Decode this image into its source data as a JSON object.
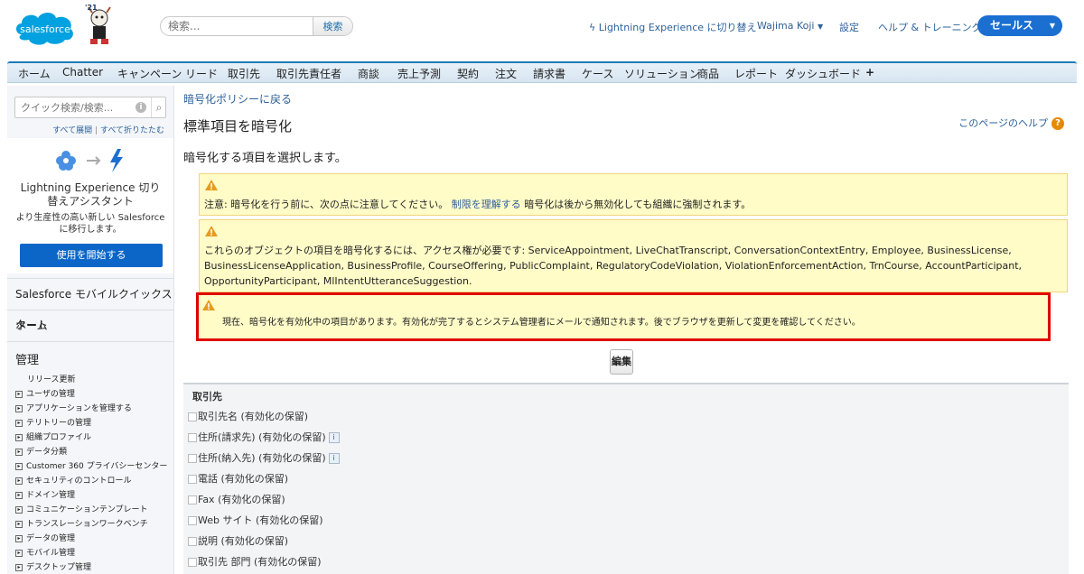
{
  "header": {
    "logo_text": "salesforce",
    "mascot_badge": "'21",
    "search_placeholder": "検索...",
    "search_button": "検索",
    "lightning_link": "Lightning Experience に切り替え",
    "user_menu": "Wajima Koji",
    "setup_link": "設定",
    "help_link": "ヘルプ & トレーニング",
    "app_switcher": "セールス"
  },
  "tabs": [
    "ホーム",
    "Chatter",
    "キャンペーン",
    "リード",
    "取引先",
    "取引先責任者",
    "商談",
    "売上予測",
    "契約",
    "注文",
    "請求書",
    "ケース",
    "ソリューション",
    "商品",
    "レポート",
    "ダッシュボード",
    "+"
  ],
  "sidebar": {
    "quick_search_placeholder": "クイック検索/検索...",
    "expand_all": "すべて展開",
    "collapse_all": "すべて折りたたむ",
    "separator": "|",
    "assistant_title": "Lightning Experience 切り替えアシスタント",
    "assistant_desc": "より生産性の高い新しい Salesforce に移行します。",
    "assistant_button": "使用を開始する",
    "mobile_quickstart": "Salesforce モバイルクイックスタート",
    "home": "ホーム",
    "admin_title": "管理",
    "release_updates": "リリース更新",
    "admin_items": [
      "ユーザの管理",
      "アプリケーションを管理する",
      "テリトリーの管理",
      "組織プロファイル",
      "データ分類",
      "Customer 360 プライバシーセンター",
      "セキュリティのコントロール",
      "ドメイン管理",
      "コミュニケーションテンプレート",
      "トランスレーションワークベンチ",
      "データの管理",
      "モバイル管理",
      "デスクトップ管理"
    ]
  },
  "main": {
    "back_link": "暗号化ポリシーに戻る",
    "title": "標準項目を暗号化",
    "help_link": "このページのヘルプ",
    "instruction": "暗号化する項目を選択します。",
    "warning1_prefix": "注意: 暗号化を行う前に、次の点に注意してください。",
    "warning1_link": "制限を理解する",
    "warning1_suffix": "暗号化は後から無効化しても組織に強制されます。",
    "warning2": "これらのオブジェクトの項目を暗号化するには、アクセス権が必要です: ServiceAppointment, LiveChatTranscript, ConversationContextEntry, Employee, BusinessLicense, BusinessLicenseApplication, BusinessProfile, CourseOffering, PublicComplaint, RegulatoryCodeViolation, ViolationEnforcementAction, TrnCourse, AccountParticipant, OpportunityParticipant, MlIntentUtteranceSuggestion.",
    "warning3": "現在、暗号化を有効化中の項目があります。有効化が完了するとシステム管理者にメールで通知されます。後でブラウザを更新して変更を確認してください。",
    "edit_button": "編集",
    "section_title": "取引先",
    "fields": [
      "取引先名 (有効化の保留)",
      "住所(請求先) (有効化の保留)",
      "住所(納入先) (有効化の保留)",
      "電話 (有効化の保留)",
      "Fax (有効化の保留)",
      "Web サイト (有効化の保留)",
      "説明 (有効化の保留)",
      "取引先 部門 (有効化の保留)"
    ],
    "info_glyph": "i"
  },
  "colors": {
    "brand_blue": "#00a1e0",
    "tab_border": "#1f7ab8",
    "link": "#2d6199",
    "warning_bg": "#fffcc8",
    "highlight_border": "#e00000",
    "app_switch_bg": "#1b6fd1"
  }
}
